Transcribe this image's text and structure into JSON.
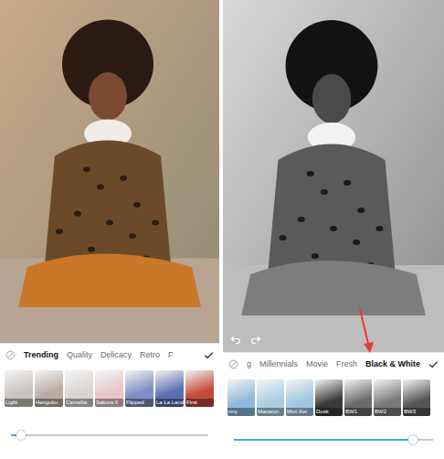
{
  "screens": [
    {
      "photo": {
        "kind": "color"
      },
      "undo_redo": false,
      "tabs": [
        {
          "label": "Trending",
          "selected": true
        },
        {
          "label": "Quality",
          "selected": false
        },
        {
          "label": "Delicacy",
          "selected": false
        },
        {
          "label": "Retro",
          "selected": false
        },
        {
          "label": "F",
          "selected": false
        }
      ],
      "filters": [
        {
          "label": "Light",
          "color": "#c9c3bd"
        },
        {
          "label": "Hanguku",
          "color": "#b9aca2"
        },
        {
          "label": "Camellia",
          "color": "#d9d4cf"
        },
        {
          "label": "Sakura II",
          "color": "#e7c6cb"
        },
        {
          "label": "Flipped",
          "color": "#7b8fc4"
        },
        {
          "label": "La La Land",
          "color": "#5a6fb0"
        },
        {
          "label": "First",
          "color": "#c44a3c"
        }
      ],
      "slider": {
        "level": 0.05
      }
    },
    {
      "photo": {
        "kind": "bw"
      },
      "undo_redo": true,
      "tabs": [
        {
          "label": "g",
          "selected": false
        },
        {
          "label": "Millennials",
          "selected": false
        },
        {
          "label": "Movie",
          "selected": false
        },
        {
          "label": "Fresh",
          "selected": false
        },
        {
          "label": "Black & White",
          "selected": true
        }
      ],
      "filters": [
        {
          "label": "nny",
          "color": "#8fb8d8"
        },
        {
          "label": "Macaron",
          "color": "#a9cde4"
        },
        {
          "label": "Mori Kei",
          "color": "#9fc6e0"
        },
        {
          "label": "Dusk",
          "color": "#3a3a3a"
        },
        {
          "label": "BW1",
          "color": "#6b6b6b"
        },
        {
          "label": "BW2",
          "color": "#7a7a7a"
        },
        {
          "label": "BW3",
          "color": "#555555"
        }
      ],
      "slider": {
        "level": 0.9
      }
    }
  ]
}
